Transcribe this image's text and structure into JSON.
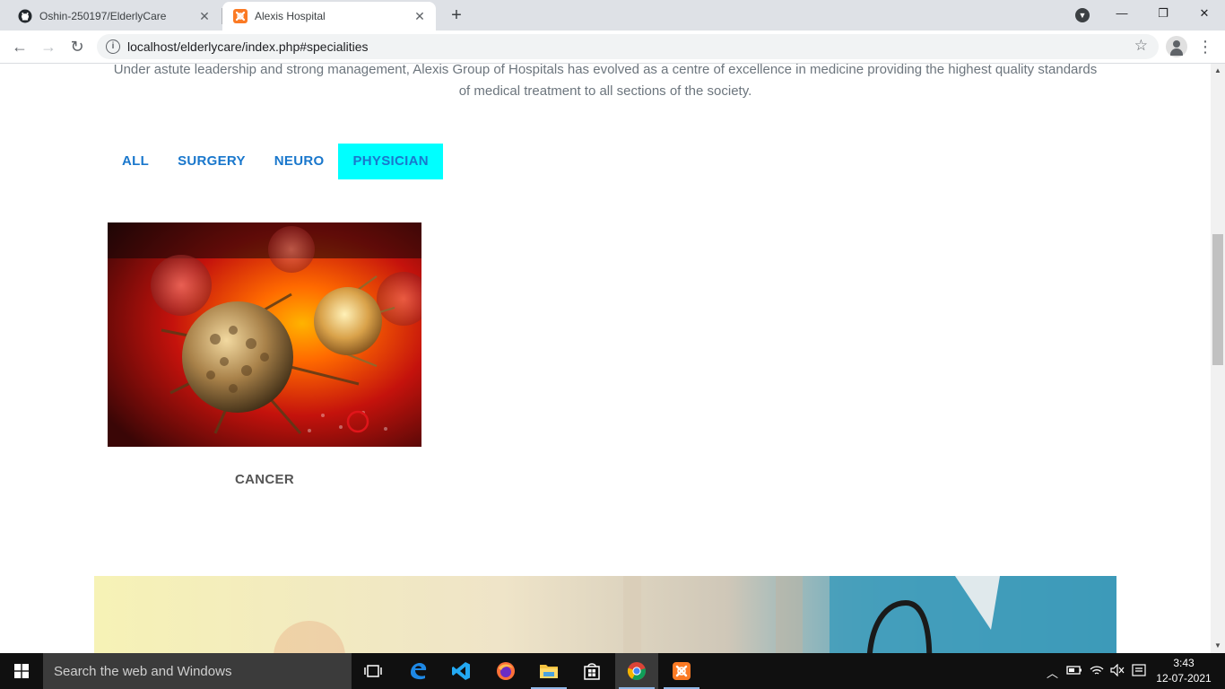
{
  "browser": {
    "tabs": [
      {
        "title": "Oshin-250197/ElderlyCare",
        "favicon": "github-icon",
        "active": false
      },
      {
        "title": "Alexis Hospital",
        "favicon": "xampp-icon",
        "active": true
      }
    ],
    "close_glyph": "✕",
    "new_tab_glyph": "+",
    "url": "localhost/elderlycare/index.php#specialities",
    "nav": {
      "back": "←",
      "forward": "→",
      "reload": "↻"
    },
    "star_glyph": "☆",
    "menu_glyph": "⋮",
    "window": {
      "minimize": "—",
      "restore": "❐",
      "close": "✕"
    }
  },
  "page": {
    "intro_text": "Under astute leadership and strong management, Alexis Group of Hospitals has evolved as a centre of excellence in medicine providing the highest quality standards of medical treatment to all sections of the society.",
    "filters": [
      {
        "label": "ALL",
        "active": false
      },
      {
        "label": "SURGERY",
        "active": false
      },
      {
        "label": "NEURO",
        "active": false
      },
      {
        "label": "PHYSICIAN",
        "active": true
      }
    ],
    "specialities": [
      {
        "caption": "CANCER",
        "image": "cancer-cells-photo"
      }
    ],
    "colors": {
      "filter_text": "#1977cc",
      "filter_active_bg": "#00ffff",
      "intro_text": "#6c757d"
    }
  },
  "taskbar": {
    "search_placeholder": "Search the web and Windows",
    "apps": [
      "task-view-icon",
      "edge-icon",
      "vscode-icon",
      "firefox-icon",
      "file-explorer-icon",
      "store-icon",
      "chrome-icon",
      "xampp-icon"
    ],
    "clock": {
      "time": "3:43",
      "date": "12-07-2021"
    }
  }
}
